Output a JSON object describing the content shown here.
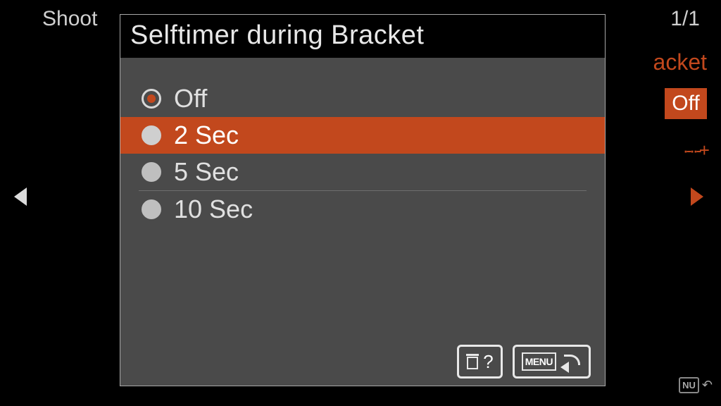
{
  "background": {
    "top_label": "Shoot",
    "page_indicator": "1/1",
    "right_word": "acket",
    "right_value": "Off",
    "right_decor": "·-··-+"
  },
  "dialog": {
    "title": "Selftimer during Bracket",
    "options": [
      {
        "label": "Off",
        "selected": true,
        "highlighted": false
      },
      {
        "label": "2 Sec",
        "selected": false,
        "highlighted": true
      },
      {
        "label": "5 Sec",
        "selected": false,
        "highlighted": false
      },
      {
        "label": "10 Sec",
        "selected": false,
        "highlighted": false
      }
    ],
    "footer": {
      "help_symbol": "?",
      "menu_label": "MENU"
    }
  }
}
